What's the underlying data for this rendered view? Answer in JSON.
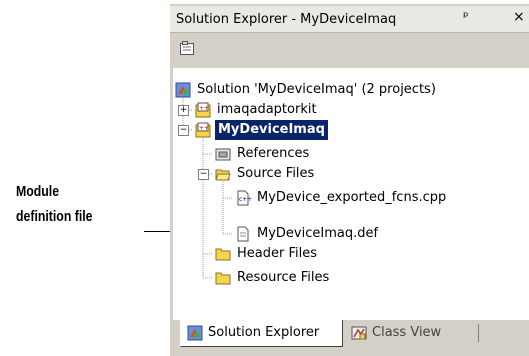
{
  "callout": {
    "line1": "Module",
    "line2": "definition file"
  },
  "panel": {
    "title": "Solution Explorer - MyDeviceImaq",
    "pin_glyph": "ᵖ",
    "close_glyph": "×",
    "icons": {
      "pin": "pin-icon",
      "close": "close-icon",
      "properties": "properties-icon"
    }
  },
  "tree": {
    "solution": "Solution 'MyDeviceImaq' (2 projects)",
    "project1": "imaqadaptorkit",
    "project2": "MyDeviceImaq",
    "references": "References",
    "source_files": "Source Files",
    "file_cpp": "MyDevice_exported_fcns.cpp",
    "file_def": "MyDeviceImaq.def",
    "header_files": "Header Files",
    "resource_files": "Resource Files"
  },
  "tabs": {
    "solution_explorer": "Solution Explorer",
    "class_view": "Class View"
  },
  "colors": {
    "selection": "#0a246a",
    "folder": "#f5d34a",
    "panel_bg": "#d4d0c8"
  }
}
